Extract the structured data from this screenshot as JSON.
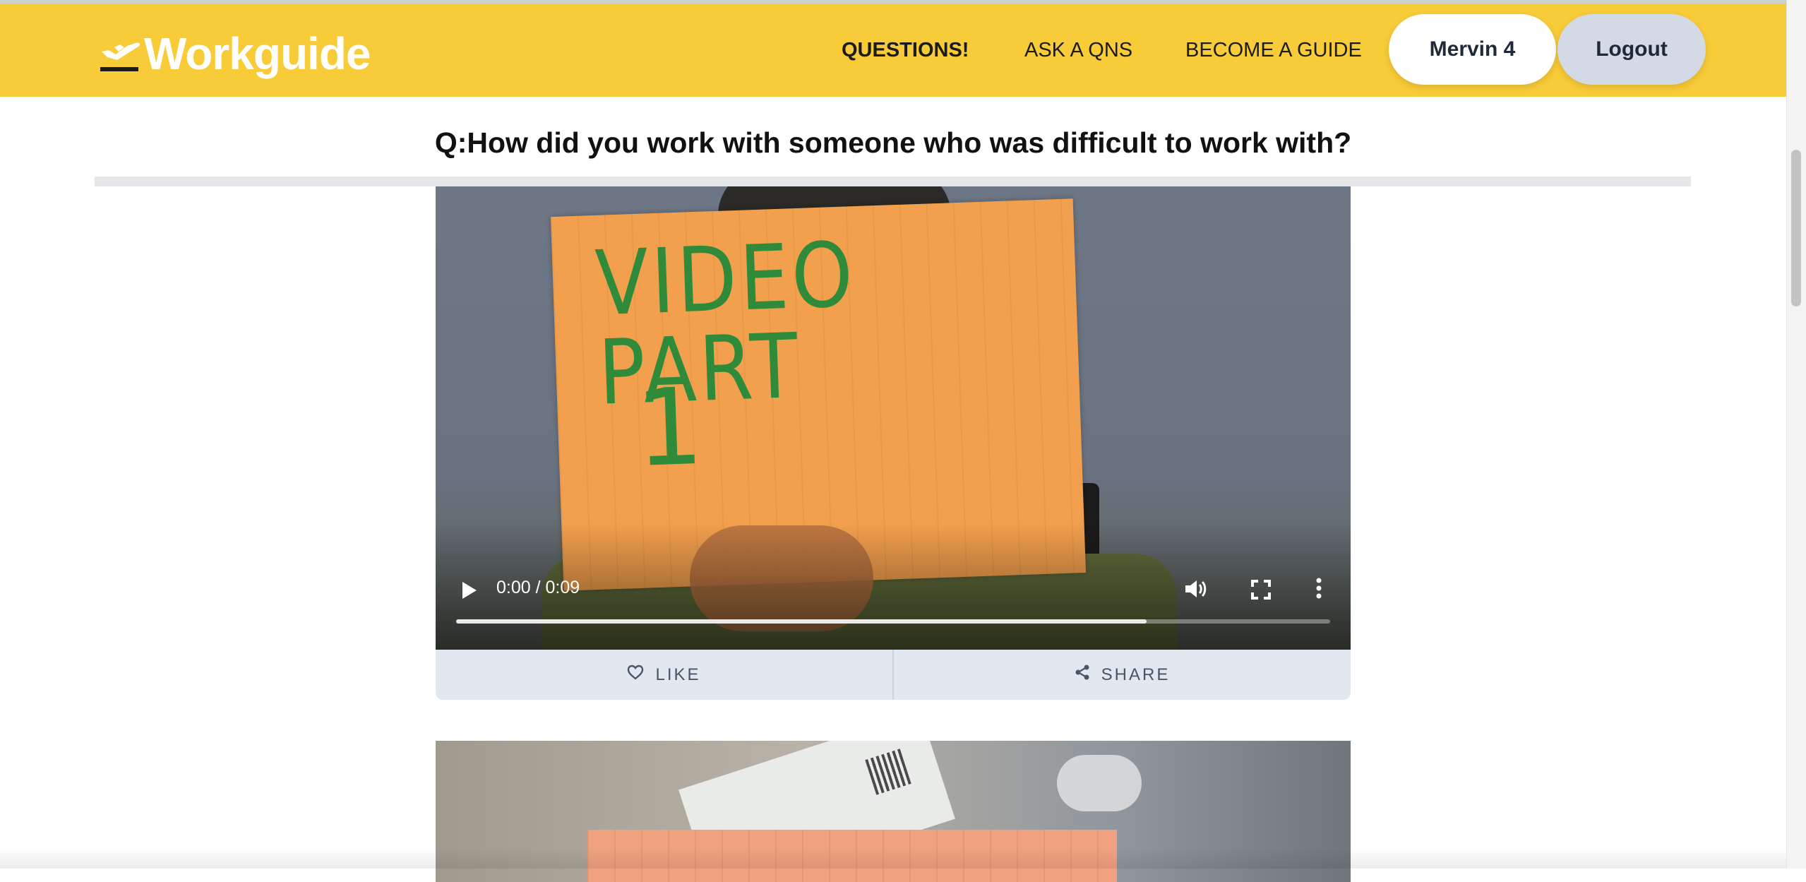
{
  "brand": {
    "name": "Workguide",
    "icon": "plane-departure-icon",
    "color": "#f8cb38"
  },
  "nav": {
    "links": [
      {
        "label": "QUESTIONS!",
        "active": true
      },
      {
        "label": "ASK A QNS",
        "active": false
      },
      {
        "label": "BECOME A GUIDE",
        "active": false
      }
    ],
    "user_label": "Mervin 4",
    "logout_label": "Logout"
  },
  "question": {
    "text": "Q:How did you work with someone who was difficult to work with?"
  },
  "videos": [
    {
      "card_text": "VIDEO PART",
      "card_number": "1",
      "time": "0:00 / 0:09",
      "progress": 0.79,
      "actions": {
        "like_label": "LIKE",
        "share_label": "SHARE"
      }
    }
  ]
}
